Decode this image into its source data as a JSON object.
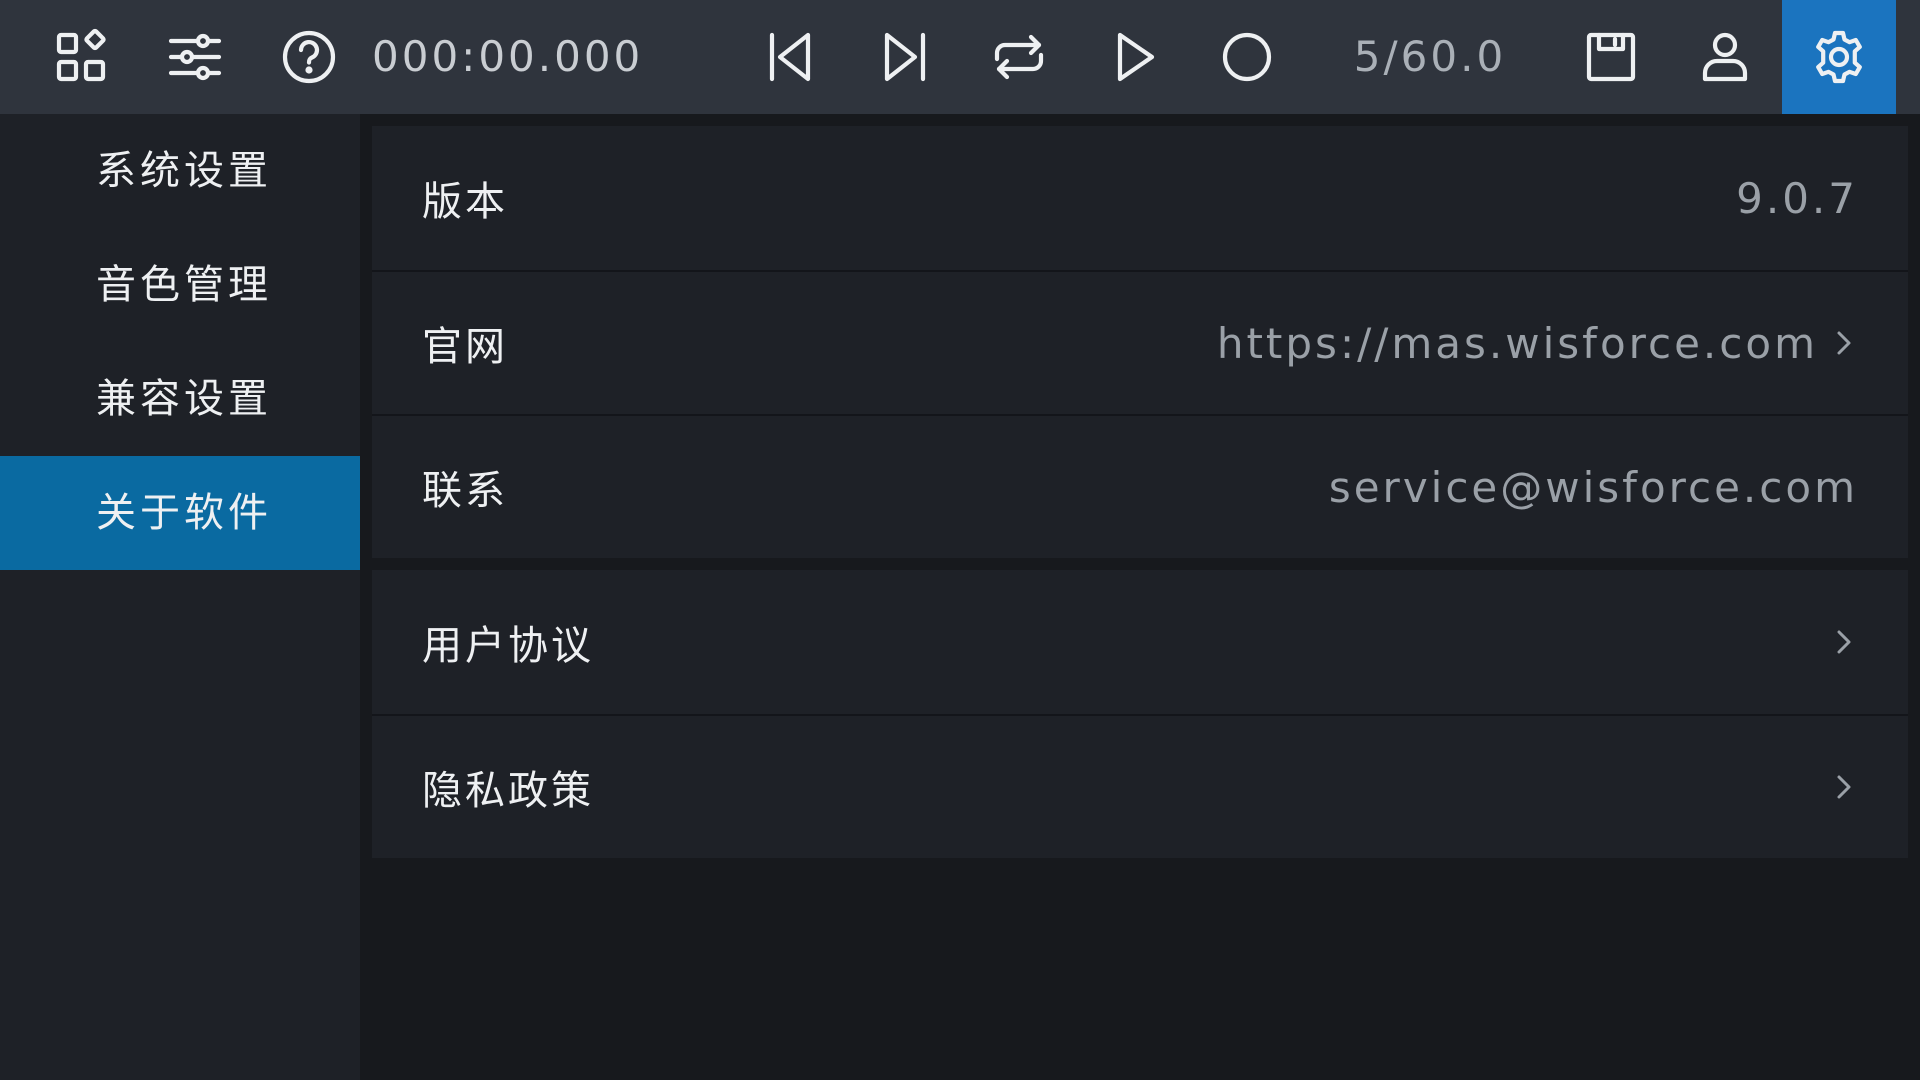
{
  "toolbar": {
    "timecode": "000:00.000",
    "bpm": "5/60.0",
    "active_color": "#1b74bf",
    "icons": [
      "apps-icon",
      "sliders-icon",
      "help-icon",
      "skip-back-icon",
      "skip-forward-icon",
      "loop-icon",
      "play-icon",
      "record-icon",
      "save-icon",
      "user-icon",
      "gear-icon"
    ]
  },
  "sidebar": {
    "items": [
      {
        "label": "系统设置"
      },
      {
        "label": "音色管理"
      },
      {
        "label": "兼容设置"
      },
      {
        "label": "关于软件",
        "active": true
      }
    ]
  },
  "about": {
    "group1": [
      {
        "label": "版本",
        "value": "9.0.7"
      },
      {
        "label": "官网",
        "value": "https://mas.wisforce.com"
      },
      {
        "label": "联系",
        "value": "service@wisforce.com"
      }
    ],
    "group2": [
      {
        "label": "用户协议"
      },
      {
        "label": "隐私政策"
      }
    ]
  }
}
